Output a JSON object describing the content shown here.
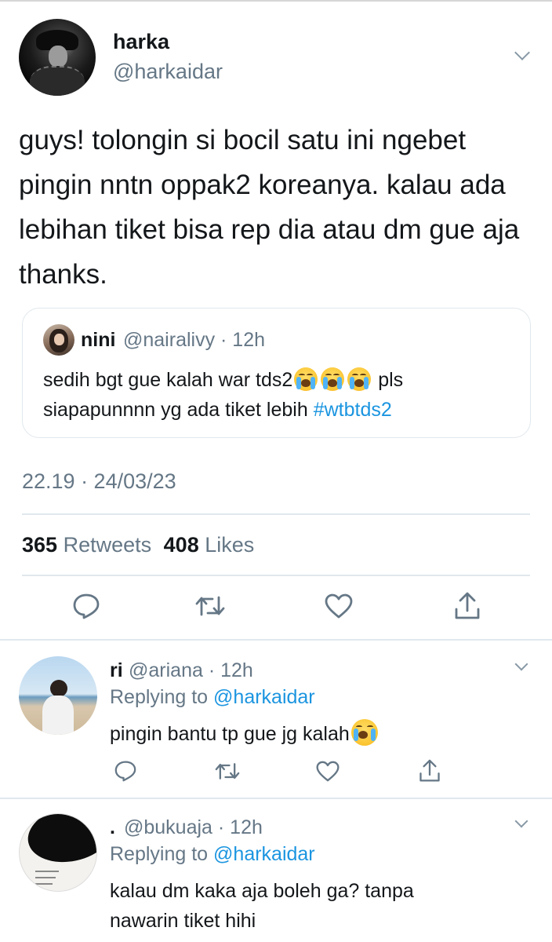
{
  "colors": {
    "text": "#14171a",
    "secondary": "#657786",
    "link": "#1b95e0",
    "border": "#e1e8ed"
  },
  "tweet": {
    "author_name": "harka",
    "author_handle": "@harkaidar",
    "text": "guys! tolongin si bocil satu ini ngebet pingin nntn oppak2 koreanya. kalau ada lebihan tiket bisa rep dia atau dm gue aja thanks.",
    "timestamp": "22.19 · 24/03/23",
    "retweets_count": "365",
    "retweets_label": "Retweets",
    "likes_count": "408",
    "likes_label": "Likes"
  },
  "quoted": {
    "name": "nini",
    "handle_time": "@nairalivy · 12h",
    "text_before": "sedih bgt gue kalah war tds2",
    "text_after": " pls siapapunnnn yg ada tiket lebih ",
    "hashtag": "#wtbtds2",
    "emoji": "loudly-crying-face"
  },
  "actions": [
    {
      "icon": "reply-icon"
    },
    {
      "icon": "retweet-icon"
    },
    {
      "icon": "like-icon"
    },
    {
      "icon": "share-icon"
    }
  ],
  "replies": [
    {
      "name": "ri",
      "handle_time": "@ariana · 12h",
      "replying_prefix": "Replying to ",
      "replying_mention": "@harkaidar",
      "text": "pingin bantu tp gue jg kalah",
      "emoji": "loudly-crying-face"
    },
    {
      "name": ".",
      "handle_time": "@bukuaja · 12h",
      "replying_prefix": "Replying to ",
      "replying_mention": "@harkaidar",
      "text": "kalau dm kaka aja boleh ga? tanpa nawarin tiket hihi"
    }
  ]
}
